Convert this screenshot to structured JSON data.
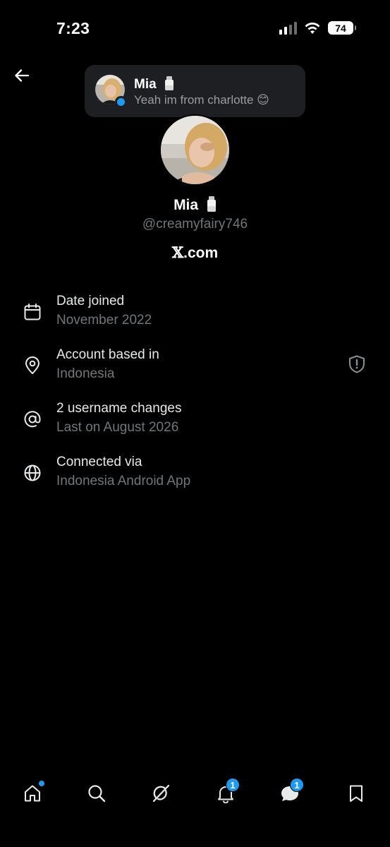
{
  "status_bar": {
    "time": "7:23",
    "battery": "74"
  },
  "toast": {
    "name": "Mia",
    "message": "Yeah im from charlotte 😊"
  },
  "profile": {
    "name": "Mia",
    "handle": "@creamyfairy746",
    "site_mark": "𝕏",
    "site_suffix": ".com"
  },
  "info": [
    {
      "icon": "calendar-icon",
      "title": "Date joined",
      "subtitle": "November 2022"
    },
    {
      "icon": "location-pin-icon",
      "title": "Account based in",
      "subtitle": "Indonesia"
    },
    {
      "icon": "at-sign-icon",
      "title": "2 username changes",
      "subtitle": "Last on August 2026"
    },
    {
      "icon": "globe-icon",
      "title": "Connected via",
      "subtitle": "Indonesia Android App"
    }
  ],
  "nav": {
    "items": [
      "home-icon",
      "search-icon",
      "grok-icon",
      "notifications-icon",
      "messages-icon",
      "bookmark-icon"
    ],
    "notifications_badge": "1",
    "messages_badge": "1"
  },
  "colors": {
    "accent": "#1d9bf0",
    "muted": "#71767b",
    "toast_bg": "#1e1f22"
  }
}
